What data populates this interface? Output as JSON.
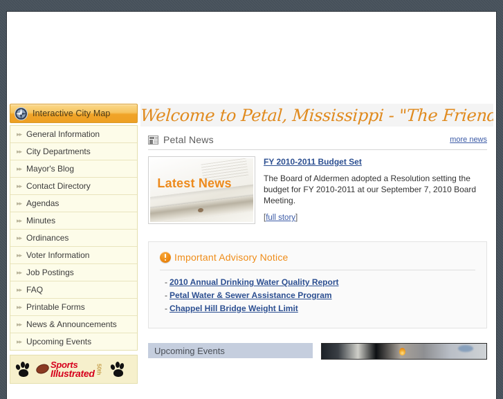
{
  "theme": {
    "page_background": "#454f59",
    "accent_orange": "#e08a1e",
    "link_blue": "#2c4f91",
    "sidebar_cream": "#fdfce9",
    "events_bar_blue": "#c5cede"
  },
  "sidebar": {
    "map_button": {
      "label": "Interactive City Map",
      "icon": "compass-icon"
    },
    "items": [
      {
        "label": "General Information"
      },
      {
        "label": "City Departments"
      },
      {
        "label": "Mayor's Blog"
      },
      {
        "label": "Contact Directory"
      },
      {
        "label": "Agendas"
      },
      {
        "label": "Minutes"
      },
      {
        "label": "Ordinances"
      },
      {
        "label": "Voter Information"
      },
      {
        "label": "Job Postings"
      },
      {
        "label": "FAQ"
      },
      {
        "label": "Printable Forms"
      },
      {
        "label": "News & Announcements"
      },
      {
        "label": "Upcoming Events"
      }
    ],
    "banner": {
      "line1": "Sports",
      "line2": "Illustrated",
      "anniversary": "50th"
    }
  },
  "main": {
    "welcome_title": "Welcome to Petal, Mississippi - \"The Friendly City\"",
    "news": {
      "section_title": "Petal News",
      "section_icon": "newspaper-icon",
      "more_link": "more news",
      "thumb_caption": "Latest News",
      "headline": "FY 2010-2011 Budget Set",
      "summary": "The Board of Aldermen adopted a Resolution setting the budget for FY 2010-2011 at our September 7, 2010 Board Meeting.",
      "full_story_open": "[",
      "full_story": "full story",
      "full_story_close": "]"
    },
    "advisory": {
      "title": "Important Advisory Notice",
      "icon": "warning-icon",
      "items": [
        {
          "dash": "-",
          "label": "2010 Annual Drinking Water Quality Report"
        },
        {
          "dash": "-",
          "label": "Petal Water & Sewer Assistance Program"
        },
        {
          "dash": "-",
          "label": "Chappel Hill Bridge Weight Limit"
        }
      ]
    },
    "lower": {
      "events_title": "Upcoming Events"
    }
  }
}
